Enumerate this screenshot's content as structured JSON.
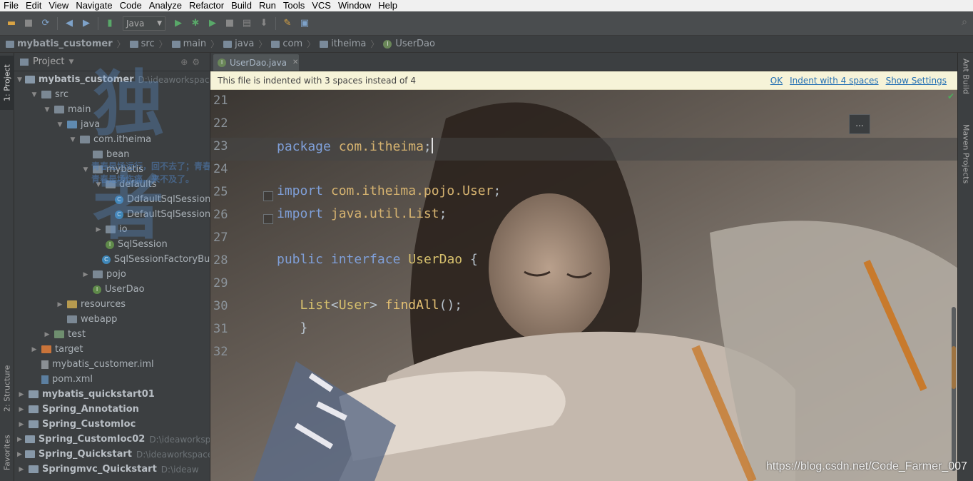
{
  "menu": [
    "File",
    "Edit",
    "View",
    "Navigate",
    "Code",
    "Analyze",
    "Refactor",
    "Build",
    "Run",
    "Tools",
    "VCS",
    "Window",
    "Help"
  ],
  "toolbar": {
    "run_config": "Java"
  },
  "breadcrumb": [
    "mybatis_customer",
    "src",
    "main",
    "java",
    "com",
    "itheima",
    "UserDao"
  ],
  "left_strip": {
    "project_tab": "1: Project",
    "structure_tab": "2: Structure",
    "favorites_tab": "Favorites"
  },
  "project_panel": {
    "title": "Project"
  },
  "tree": [
    {
      "label": "mybatis_customer",
      "path": "D:\\ideaworkspace",
      "indent": 0,
      "arrow": "▼",
      "icon": "module",
      "bold": true
    },
    {
      "label": "src",
      "indent": 1,
      "arrow": "▼",
      "icon": "folder"
    },
    {
      "label": "main",
      "indent": 2,
      "arrow": "▼",
      "icon": "folder"
    },
    {
      "label": "java",
      "indent": 3,
      "arrow": "▼",
      "icon": "folder src"
    },
    {
      "label": "com.itheima",
      "indent": 4,
      "arrow": "▼",
      "icon": "folder"
    },
    {
      "label": "bean",
      "indent": 5,
      "arrow": "",
      "icon": "folder"
    },
    {
      "label": "mybatis",
      "indent": 5,
      "arrow": "▼",
      "icon": "folder"
    },
    {
      "label": "defaults",
      "indent": 6,
      "arrow": "▼",
      "icon": "folder"
    },
    {
      "label": "DdfaultSqlSession",
      "indent": 7,
      "arrow": "",
      "icon": "cls"
    },
    {
      "label": "DefaultSqlSessionF",
      "indent": 7,
      "arrow": "",
      "icon": "cls"
    },
    {
      "label": "io",
      "indent": 6,
      "arrow": "▶",
      "icon": "folder"
    },
    {
      "label": "SqlSession",
      "indent": 6,
      "arrow": "",
      "icon": "intf"
    },
    {
      "label": "SqlSessionFactoryBuil",
      "indent": 6,
      "arrow": "",
      "icon": "cls"
    },
    {
      "label": "pojo",
      "indent": 5,
      "arrow": "▶",
      "icon": "folder"
    },
    {
      "label": "UserDao",
      "indent": 5,
      "arrow": "",
      "icon": "intf"
    },
    {
      "label": "resources",
      "indent": 3,
      "arrow": "▶",
      "icon": "folder res"
    },
    {
      "label": "webapp",
      "indent": 3,
      "arrow": "",
      "icon": "folder"
    },
    {
      "label": "test",
      "indent": 2,
      "arrow": "▶",
      "icon": "folder test"
    },
    {
      "label": "target",
      "indent": 1,
      "arrow": "▶",
      "icon": "folder orange"
    },
    {
      "label": "mybatis_customer.iml",
      "indent": 1,
      "arrow": "",
      "icon": "file"
    },
    {
      "label": "pom.xml",
      "indent": 1,
      "arrow": "",
      "icon": "xml"
    },
    {
      "label": "mybatis_quickstart01",
      "indent": 0,
      "arrow": "▶",
      "icon": "module",
      "bold": true
    },
    {
      "label": "Spring_Annotation",
      "indent": 0,
      "arrow": "▶",
      "icon": "module",
      "bold": true
    },
    {
      "label": "Spring_CustomIoc",
      "indent": 0,
      "arrow": "▶",
      "icon": "module",
      "bold": true
    },
    {
      "label": "Spring_CustomIoc02",
      "path": "D:\\ideaworkspace",
      "indent": 0,
      "arrow": "▶",
      "icon": "module",
      "bold": true
    },
    {
      "label": "Spring_Quickstart",
      "path": "D:\\ideaworkspace",
      "indent": 0,
      "arrow": "▶",
      "icon": "module",
      "bold": true
    },
    {
      "label": "Springmvc_Quickstart",
      "path": "D:\\ideaw",
      "indent": 0,
      "arrow": "▶",
      "icon": "module",
      "bold": true
    }
  ],
  "editor": {
    "tab_label": "UserDao.java",
    "notice_text": "This file is indented with 3 spaces instead of 4",
    "notice_ok": "OK",
    "notice_indent": "Indent with 4 spaces",
    "notice_settings": "Show Settings",
    "ellipsis": "...",
    "line_numbers": [
      "21",
      "22",
      "23",
      "24",
      "25",
      "26",
      "27",
      "28",
      "29",
      "30",
      "31",
      "32"
    ]
  },
  "right_strip": {
    "ant_build": "Ant Build",
    "maven": "Maven Projects"
  },
  "background": {
    "big_char": "独者",
    "poem": "青春是场远行，回不去了；青春是场相逢，忘不掉了；\n青春是场伤痛，来不及了。"
  },
  "watermark": "https://blog.csdn.net/Code_Farmer_007",
  "colors": {
    "keyword": "#7f9fd8",
    "package": "#d6b370",
    "notice_bg": "#f6f3d8",
    "link": "#2470b3"
  }
}
